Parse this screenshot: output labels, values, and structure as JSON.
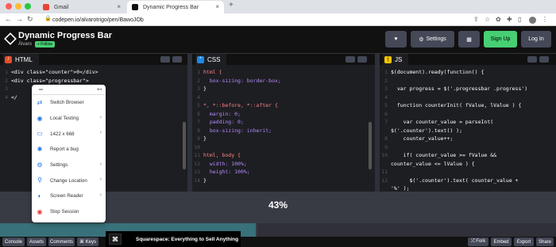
{
  "browser": {
    "tabs": [
      {
        "label": "Gmail",
        "active": false
      },
      {
        "label": "Dynamic Progress Bar",
        "active": true
      }
    ],
    "new_tab": "+",
    "url": "codepen.io/alvarotrigo/pen/BawoJOb",
    "colors": {
      "close": "#ff5f57",
      "minimize": "#febc2e",
      "maximize": "#28c840"
    }
  },
  "header": {
    "title": "Dynamic Progress Bar",
    "author": "Álvaro",
    "follow_label": "+ Follow",
    "heart_icon": "♥",
    "settings_label": "Settings",
    "layout_icon": "▦",
    "signup_label": "Sign Up",
    "login_label": "Log In"
  },
  "panes": {
    "html": {
      "label": "HTML",
      "lines": [
        {
          "n": "1",
          "t": "<div class=\"counter\">0</div>"
        },
        {
          "n": "2",
          "t": "<div class=\"progressbar\">"
        },
        {
          "n": "3",
          "t": "                     </span>"
        },
        {
          "n": "4",
          "t": "</"
        }
      ]
    },
    "css": {
      "label": "CSS",
      "lines": [
        {
          "n": "1",
          "t": "html {"
        },
        {
          "n": "2",
          "t": "  box-sizing: border-box;"
        },
        {
          "n": "3",
          "t": "}"
        },
        {
          "n": "4",
          "t": ""
        },
        {
          "n": "5",
          "t": "*, *::before, *::after {"
        },
        {
          "n": "6",
          "t": "  margin: 0;"
        },
        {
          "n": "7",
          "t": "  padding: 0;"
        },
        {
          "n": "8",
          "t": "  box-sizing: inherit;"
        },
        {
          "n": "9",
          "t": "}"
        },
        {
          "n": "10",
          "t": ""
        },
        {
          "n": "11",
          "t": "html, body {"
        },
        {
          "n": "12",
          "t": "  width: 100%;"
        },
        {
          "n": "13",
          "t": "  height: 100%;"
        },
        {
          "n": "14",
          "t": "}"
        }
      ]
    },
    "js": {
      "label": "JS",
      "lines": [
        {
          "n": "1",
          "t": "$(document).ready(function() {"
        },
        {
          "n": "2",
          "t": ""
        },
        {
          "n": "3",
          "t": "  var progress = $('.progressbar .progress')"
        },
        {
          "n": "4",
          "t": ""
        },
        {
          "n": "5",
          "t": "  function counterInit( fValue, lValue ) {"
        },
        {
          "n": "6",
          "t": ""
        },
        {
          "n": "7",
          "t": "    var counter_value = parseInt("
        },
        {
          "n": "",
          "t": "$('.counter').text() );"
        },
        {
          "n": "8",
          "t": "    counter_value++;"
        },
        {
          "n": "9",
          "t": ""
        },
        {
          "n": "10",
          "t": "    if( counter_value >= fValue &&"
        },
        {
          "n": "",
          "t": "counter_value <= lValue ) {"
        },
        {
          "n": "11",
          "t": ""
        },
        {
          "n": "12",
          "t": "      $('.counter').text( counter_value +"
        },
        {
          "n": "",
          "t": "'%' );"
        }
      ]
    }
  },
  "preview": {
    "percent_text": "43%",
    "progress": 0.46,
    "fill_color": "#39717a"
  },
  "context_menu": {
    "items": [
      {
        "label": "Switch Browser",
        "icon": "⇄",
        "arrow": ""
      },
      {
        "label": "Local Testing",
        "icon": "◉",
        "arrow": "›"
      },
      {
        "label": "1422 x 668",
        "icon": "▭",
        "arrow": "›"
      },
      {
        "label": "Report a bug",
        "icon": "✱",
        "arrow": ""
      },
      {
        "label": "Settings",
        "icon": "⚙",
        "arrow": "›"
      },
      {
        "label": "Change Location",
        "icon": "⚲",
        "arrow": "›"
      },
      {
        "label": "Screen Reader",
        "icon": "◐",
        "arrow": "›"
      },
      {
        "label": "Stop Session",
        "icon": "◉",
        "arrow": ""
      }
    ]
  },
  "footer": {
    "left": [
      "Console",
      "Assets",
      "Comments",
      "⌘ Keys"
    ],
    "right": [
      "⤮ Fork",
      "Embed",
      "Export",
      "Share"
    ]
  },
  "ad": {
    "text": "Squarespace: Everything to Sell Anything"
  }
}
